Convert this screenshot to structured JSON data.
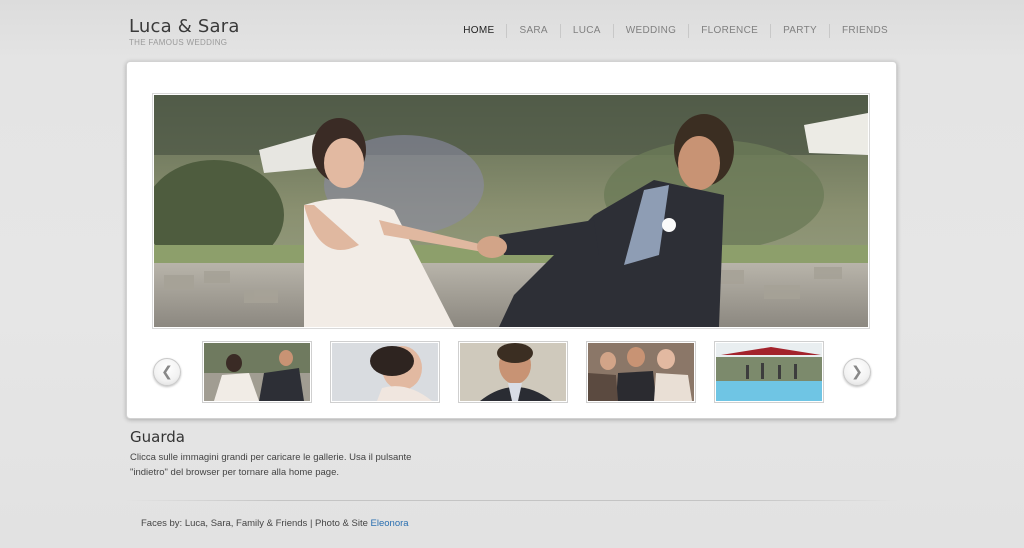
{
  "header": {
    "title": "Luca & Sara",
    "subtitle": "THE FAMOUS WEDDING"
  },
  "nav": {
    "items": [
      {
        "label": "HOME",
        "active": true
      },
      {
        "label": "SARA"
      },
      {
        "label": "LUCA"
      },
      {
        "label": "WEDDING"
      },
      {
        "label": "FLORENCE"
      },
      {
        "label": "PARTY"
      },
      {
        "label": "FRIENDS"
      }
    ]
  },
  "slider": {
    "prev_icon": "chevron-left-icon",
    "next_icon": "chevron-right-icon",
    "thumbnails": 5
  },
  "content": {
    "title": "Guarda",
    "text_line1": "Clicca sulle immagini grandi per caricare le gallerie. Usa il pulsante",
    "text_line2": "\"indietro\" del browser per tornare alla home page."
  },
  "footer": {
    "text": "Faces by: Luca, Sara, Family & Friends | Photo & Site ",
    "link": "Eleonora"
  },
  "colors": {
    "link": "#2a6fb0",
    "nav_active": "#222222",
    "nav_inactive": "#808080"
  }
}
